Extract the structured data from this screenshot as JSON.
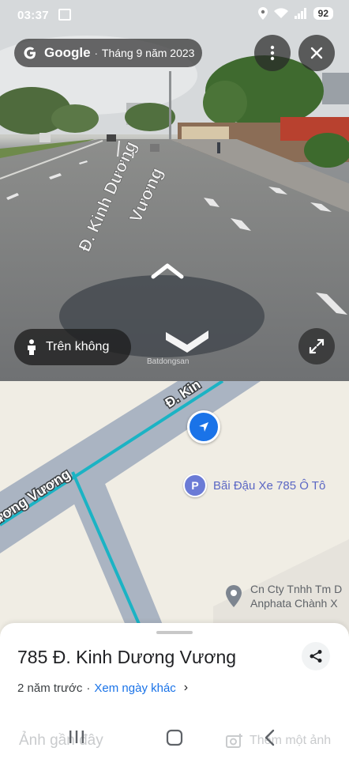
{
  "status_bar": {
    "time": "03:37",
    "battery": "92"
  },
  "street_view": {
    "brand": "Google",
    "capture_date": "Tháng 9 năm 2023",
    "aerial_button_label": "Trên không",
    "road_painted_text_line1": "Đ. Kinh Dương",
    "road_painted_text_line2": "Vương",
    "watermark": "Batdongsan"
  },
  "map": {
    "road_label_top": "Đ. Kin",
    "road_label_left": "ương Vương",
    "parking_poi": {
      "icon": "P",
      "label": "Bãi Đậu Xe 785 Ô Tô"
    },
    "company_poi": {
      "line1": "Cn Cty Tnhh Tm D",
      "line2": "Anphata Chành X"
    }
  },
  "place_sheet": {
    "address": "785 Đ. Kinh Dương Vương",
    "time_ago": "2 năm trước",
    "other_dates_link": "Xem ngày khác",
    "recent_photos_label": "Ảnh gần đây",
    "add_photo_label": "Thêm một ảnh"
  },
  "colors": {
    "accent": "#1a73e8",
    "route": "#1bb3c4",
    "poi": "#6b7bd6",
    "map_bg": "#f0ede4",
    "road": "#aab4c2"
  }
}
